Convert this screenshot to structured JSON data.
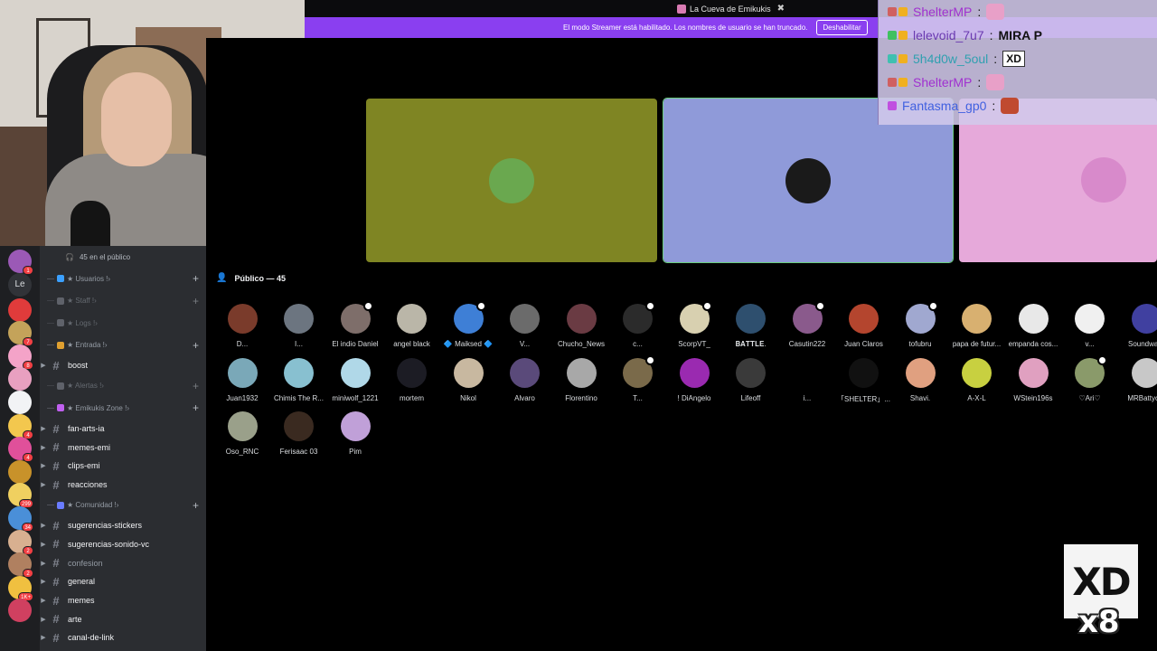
{
  "window": {
    "server_title": "La Cueva de Emikukis",
    "close_glyph": "✖"
  },
  "streamer_banner": {
    "message": "El modo Streamer está habilitado. Los nombres de usuario se han truncado.",
    "button": "Deshabilitar"
  },
  "server_rail": {
    "current_abbrev": "Le",
    "icons": [
      {
        "color": "#9b59b6",
        "badge": "1"
      },
      {
        "color": "#313338",
        "badge": ""
      },
      {
        "color": "#e03b3b",
        "badge": ""
      },
      {
        "color": "#c4a35a",
        "badge": "7"
      },
      {
        "color": "#f4a3c8",
        "badge": "8"
      },
      {
        "color": "#e8a0c0",
        "badge": ""
      },
      {
        "color": "#f2f3f5",
        "badge": ""
      },
      {
        "color": "#f3c74e",
        "badge": "4"
      },
      {
        "color": "#e0509a",
        "badge": "4"
      },
      {
        "color": "#c8922a",
        "badge": ""
      },
      {
        "color": "#f0d060",
        "badge": "299"
      },
      {
        "color": "#4a8fd8",
        "badge": "34"
      },
      {
        "color": "#d8b090",
        "badge": "2"
      },
      {
        "color": "#b08060",
        "badge": "2"
      },
      {
        "color": "#f0c040",
        "badge": "1K+"
      },
      {
        "color": "#d04060",
        "badge": ""
      }
    ]
  },
  "channels": {
    "audience_label": "45 en el público",
    "items": [
      {
        "kind": "cat",
        "label": "★ Usuarios !",
        "icon_color": "#3ba0ff",
        "dim": false,
        "plus": true
      },
      {
        "kind": "cat",
        "label": "★ Staff !",
        "icon_color": "#8a8f99",
        "dim": true,
        "plus": true
      },
      {
        "kind": "cat",
        "label": "★ Logs !",
        "icon_color": "#8a8f99",
        "dim": true,
        "plus": false
      },
      {
        "kind": "cat",
        "label": "★ Entrada !",
        "icon_color": "#e0a030",
        "dim": false,
        "plus": true
      },
      {
        "kind": "ch",
        "label": "boost",
        "muted": false
      },
      {
        "kind": "cat",
        "label": "★ Alertas !",
        "icon_color": "#8a8f99",
        "dim": true,
        "plus": true
      },
      {
        "kind": "cat",
        "label": "★ Emikukis Zone !",
        "icon_color": "#c060f0",
        "dim": false,
        "plus": true
      },
      {
        "kind": "ch",
        "label": "fan-arts-ia",
        "muted": false
      },
      {
        "kind": "ch",
        "label": "memes-emi",
        "muted": false
      },
      {
        "kind": "ch",
        "label": "clips-emi",
        "muted": false
      },
      {
        "kind": "ch",
        "label": "reacciones",
        "muted": false
      },
      {
        "kind": "cat",
        "label": "★ Comunidad !",
        "icon_color": "#6a7cff",
        "dim": false,
        "plus": true
      },
      {
        "kind": "ch",
        "label": "sugerencias-stickers",
        "muted": false
      },
      {
        "kind": "ch",
        "label": "sugerencias-sonido-vc",
        "muted": false
      },
      {
        "kind": "ch",
        "label": "confesion",
        "muted": true
      },
      {
        "kind": "ch",
        "label": "general",
        "muted": false
      },
      {
        "kind": "ch",
        "label": "memes",
        "muted": false
      },
      {
        "kind": "ch",
        "label": "arte",
        "muted": false
      },
      {
        "kind": "ch",
        "label": "canal-de-link",
        "muted": false
      }
    ]
  },
  "stage": {
    "speakers": [
      {
        "bg": "#7f8523",
        "avatar": "#6aa84f"
      },
      {
        "bg": "#8f9ad9",
        "avatar": "#1a1a1a"
      },
      {
        "bg": "#e6a9da",
        "avatar": "#d88acb"
      }
    ],
    "public_header": "Público — 45",
    "audience": [
      {
        "name": "D...",
        "color": "#7a3b2b",
        "hand": false
      },
      {
        "name": "I...",
        "color": "#6c7580",
        "hand": false
      },
      {
        "name": "El indio Daniel",
        "color": "#7e6e6a",
        "hand": true
      },
      {
        "name": "angel black",
        "color": "#bab6a8",
        "hand": false
      },
      {
        "name": "🔷 Maiksed 🔷",
        "color": "#3e7fd6",
        "hand": true
      },
      {
        "name": "V...",
        "color": "#6b6b6b",
        "hand": false
      },
      {
        "name": "Chucho_News",
        "color": "#6a3b43",
        "hand": false
      },
      {
        "name": "c...",
        "color": "#2b2b2b",
        "hand": true
      },
      {
        "name": "ScorpVT_",
        "color": "#d8d0b0",
        "hand": true
      },
      {
        "name": "𝐁𝐀𝐓𝐓𝐋𝐄.",
        "color": "#2e4f6e",
        "hand": false
      },
      {
        "name": "Casutin222",
        "color": "#8a5a8c",
        "hand": true
      },
      {
        "name": "Juan Claros",
        "color": "#b4452e",
        "hand": false
      },
      {
        "name": "tofubru",
        "color": "#a0a8d0",
        "hand": true
      },
      {
        "name": "papa de futur...",
        "color": "#d8b070",
        "hand": false
      },
      {
        "name": "empanda cos...",
        "color": "#e8e8e8",
        "hand": false
      },
      {
        "name": "v...",
        "color": "#f0f0f0",
        "hand": false
      },
      {
        "name": "Soundwa...",
        "color": "#4040a0",
        "hand": false
      },
      {
        "name": "Juan1932",
        "color": "#7aa8b8",
        "hand": false
      },
      {
        "name": "Chimis The R...",
        "color": "#88c0d0",
        "hand": false
      },
      {
        "name": "miniwolf_1221",
        "color": "#b0d8e8",
        "hand": false
      },
      {
        "name": "mortem",
        "color": "#1c1c24",
        "hand": false
      },
      {
        "name": "Nikol",
        "color": "#c8b8a0",
        "hand": false
      },
      {
        "name": "Alvaro",
        "color": "#5a4a7a",
        "hand": false
      },
      {
        "name": "Florentino",
        "color": "#a8a8a8",
        "hand": false
      },
      {
        "name": "T...",
        "color": "#7a6a4a",
        "hand": true
      },
      {
        "name": "! DiAngelo",
        "color": "#9a2ab0",
        "hand": false
      },
      {
        "name": "Lifeoff",
        "color": "#3a3a3a",
        "hand": false
      },
      {
        "name": "i...",
        "color": "#000000",
        "hand": false
      },
      {
        "name": "「SHELTER」...",
        "color": "#111111",
        "hand": false
      },
      {
        "name": "Shavi.",
        "color": "#e0a080",
        "hand": false
      },
      {
        "name": "A-X-L",
        "color": "#c8d040",
        "hand": false
      },
      {
        "name": "WStein196s",
        "color": "#e0a0c0",
        "hand": false
      },
      {
        "name": "♡Ari♡",
        "color": "#8a9a6a",
        "hand": true
      },
      {
        "name": "MRBattyc...",
        "color": "#c8c8c8",
        "hand": false
      },
      {
        "name": "Oso_RNC",
        "color": "#9aa08a",
        "hand": false
      },
      {
        "name": "Ferisaac 03",
        "color": "#3a2a20",
        "hand": false
      },
      {
        "name": "Pim",
        "color": "#c0a0d8",
        "hand": false
      }
    ]
  },
  "chat": [
    {
      "user": "ShelterMP",
      "user_color": "#a030d0",
      "badge_colors": [
        "#d06060",
        "#f0b020"
      ],
      "msg": "",
      "emote": "pink"
    },
    {
      "user": "lelevoid_7u7",
      "user_color": "#6a3ab0",
      "badge_colors": [
        "#40c060",
        "#f0b020"
      ],
      "msg": "MIRA P",
      "emote": ""
    },
    {
      "user": "5h4d0w_5oul",
      "user_color": "#30a0b0",
      "badge_colors": [
        "#40c0b0",
        "#f0b020"
      ],
      "msg": "",
      "emote": "XD"
    },
    {
      "user": "ShelterMP",
      "user_color": "#a030d0",
      "badge_colors": [
        "#d06060",
        "#f0b020"
      ],
      "msg": "",
      "emote": "pink"
    },
    {
      "user": "Fantasma_gp0",
      "user_color": "#4060e0",
      "badge_colors": [
        "#c050e0"
      ],
      "msg": "",
      "emote": "red"
    }
  ],
  "overlay": {
    "emote_text": "XD",
    "count": "x8"
  }
}
